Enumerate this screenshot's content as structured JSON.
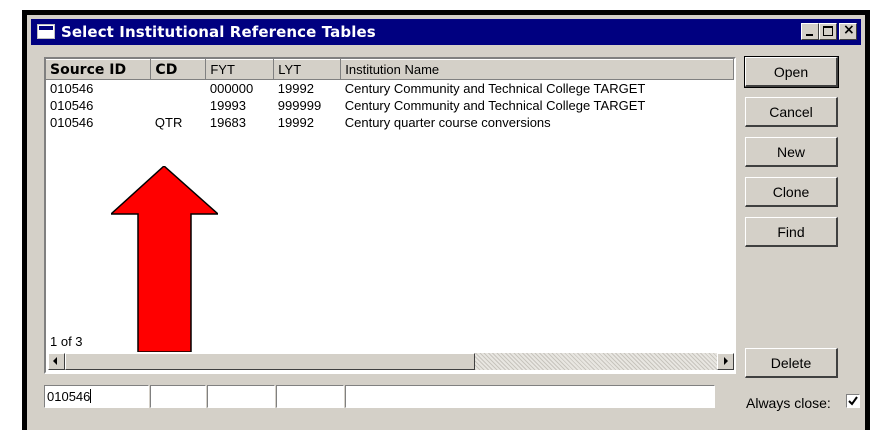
{
  "window": {
    "title": "Select Institutional Reference Tables"
  },
  "table": {
    "columns": [
      "Source ID",
      "CD",
      "FYT",
      "LYT",
      "Institution Name"
    ],
    "rows": [
      [
        "010546",
        "",
        "000000",
        "19992",
        "Century Community and Technical College TARGET"
      ],
      [
        "010546",
        "",
        "19993",
        "999999",
        "Century Community and Technical College TARGET"
      ],
      [
        "010546",
        "QTR",
        "19683",
        "19992",
        "Century quarter course conversions"
      ]
    ],
    "record_count": "1 of 3"
  },
  "buttons": {
    "open": "Open",
    "cancel": "Cancel",
    "new": "New",
    "clone": "Clone",
    "find": "Find",
    "delete": "Delete"
  },
  "filter": {
    "source_id": "010546",
    "cd": "",
    "fyt": "",
    "lyt": "",
    "institution_name": ""
  },
  "options": {
    "always_close_label": "Always close:",
    "always_close_checked": true
  },
  "annotation": {
    "arrow_color": "#ff0000",
    "arrow_direction": "up"
  }
}
